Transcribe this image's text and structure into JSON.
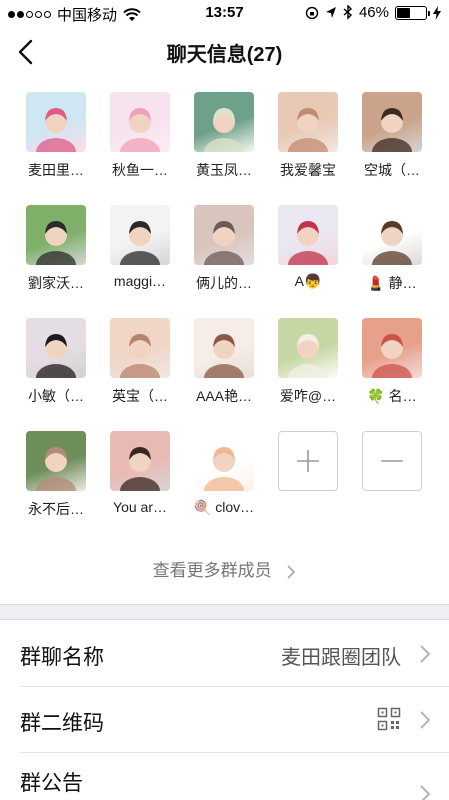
{
  "status_bar": {
    "carrier": "中国移动",
    "time": "13:57",
    "battery": "46%",
    "battery_level": 0.46
  },
  "nav": {
    "title": "聊天信息(27)"
  },
  "members": [
    {
      "name": "麦田里…"
    },
    {
      "name": "秋鱼一…"
    },
    {
      "name": "黄玉凤…"
    },
    {
      "name": "我爱馨宝"
    },
    {
      "name": "空城（…"
    },
    {
      "name": "劉家沃…"
    },
    {
      "name": "maggi…"
    },
    {
      "name": "俩儿的…"
    },
    {
      "name": "A👦"
    },
    {
      "name": "💄 静…"
    },
    {
      "name": "小敏（…"
    },
    {
      "name": "英宝（…"
    },
    {
      "name": "AAA艳…"
    },
    {
      "name": "爱咋@…"
    },
    {
      "name": "🍀 名…"
    },
    {
      "name": "永不后…"
    },
    {
      "name": "You ar…"
    },
    {
      "name": "🍭 clov…"
    }
  ],
  "actions": {
    "add": "+",
    "remove": "−"
  },
  "more_members_label": "查看更多群成员",
  "settings": {
    "group_name_label": "群聊名称",
    "group_name_value": "麦田跟圈团队",
    "qr_label": "群二维码",
    "announcement_label": "群公告"
  },
  "icons": {
    "back": "chevron-left-icon",
    "wifi": "wifi-icon",
    "qr": "qr-code-icon",
    "chevron": "chevron-right-icon"
  }
}
